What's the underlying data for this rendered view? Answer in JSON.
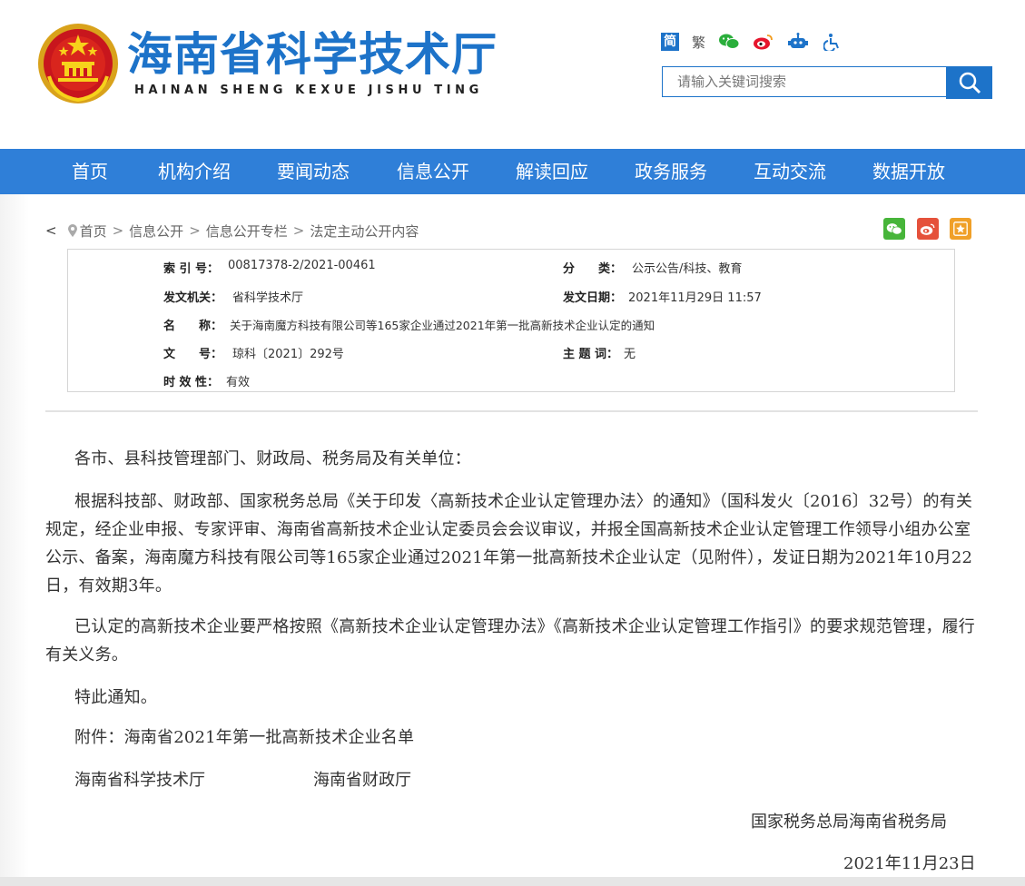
{
  "header": {
    "site_title": "海南省科学技术厅",
    "site_pinyin": "HAINAN SHENG KEXUE JISHU TING",
    "lang_simplified": "简",
    "lang_traditional": "繁",
    "tools": [
      "wechat-icon",
      "weibo-icon",
      "robot-icon",
      "accessibility-icon"
    ],
    "search_placeholder": "请输入关键词搜索",
    "brand_color": "#1d73c9"
  },
  "nav": {
    "items": [
      "首页",
      "机构介绍",
      "要闻动态",
      "信息公开",
      "解读回应",
      "政务服务",
      "互动交流",
      "数据开放"
    ],
    "bg_color": "#2f7fd8"
  },
  "breadcrumb": {
    "back": "<",
    "items": [
      "首页",
      "信息公开",
      "信息公开专栏",
      "法定主动公开内容"
    ],
    "separator": ">"
  },
  "share": {
    "icons": [
      "wechat-share-icon",
      "weibo-share-icon",
      "favorite-icon"
    ],
    "colors": [
      "#47b53a",
      "#e5513b",
      "#f0a028"
    ]
  },
  "meta": {
    "index_label": "索 引 号：",
    "index_value": "00817378-2/2021-00461",
    "category_label": "分　　类：",
    "category_value": "公示公告/科技、教育",
    "issuer_label": "发文机关：",
    "issuer_value": "省科学技术厅",
    "date_label": "发文日期：",
    "date_value": "2021年11月29日 11:57",
    "name_label": "名　　称：",
    "name_value": "关于海南魔方科技有限公司等165家企业通过2021年第一批高新技术企业认定的通知",
    "doc_no_label": "文　　号：",
    "doc_no_value": "琼科〔2021〕292号",
    "keyword_label": "主 题 词：",
    "keyword_value": "无",
    "validity_label": "时 效 性：",
    "validity_value": "有效"
  },
  "article": {
    "salutation": "各市、县科技管理部门、财政局、税务局及有关单位：",
    "para1": "根据科技部、财政部、国家税务总局《关于印发〈高新技术企业认定管理办法〉的通知》（国科发火〔2016〕32号）的有关规定，经企业申报、专家评审、海南省高新技术企业认定委员会会议审议，并报全国高新技术企业认定管理工作领导小组办公室公示、备案，海南魔方科技有限公司等165家企业通过2021年第一批高新技术企业认定（见附件），发证日期为2021年10月22日，有效期3年。",
    "para2": "已认定的高新技术企业要严格按照《高新技术企业认定管理办法》《高新技术企业认定管理工作指引》的要求规范管理，履行有关义务。",
    "notice": "特此通知。",
    "attachment": "附件：海南省2021年第一批高新技术企业名单",
    "signer1": "海南省科学技术厅",
    "signer2": "海南省财政厅",
    "signer3": "国家税务总局海南省税务局",
    "date": "2021年11月23日"
  }
}
